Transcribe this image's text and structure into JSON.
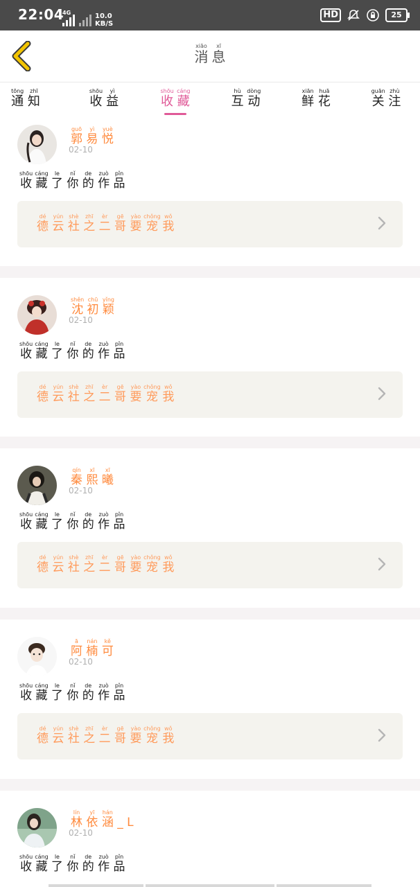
{
  "status_bar": {
    "time": "22:04",
    "net_type": "4G",
    "speed": "10.0",
    "speed_unit": "KB/S",
    "hd": "HD",
    "battery": "25"
  },
  "header": {
    "title": [
      {
        "c": "消",
        "p": "xiāo"
      },
      {
        "c": "息",
        "p": "xī"
      }
    ]
  },
  "tabs": [
    {
      "key": "notice",
      "chars": [
        {
          "c": "通",
          "p": "tōng"
        },
        {
          "c": "知",
          "p": "zhī"
        }
      ]
    },
    {
      "key": "income",
      "chars": [
        {
          "c": "收",
          "p": "shōu"
        },
        {
          "c": "益",
          "p": "yì"
        }
      ]
    },
    {
      "key": "favorite",
      "chars": [
        {
          "c": "收",
          "p": "shōu"
        },
        {
          "c": "藏",
          "p": "cáng"
        }
      ],
      "active": true
    },
    {
      "key": "interact",
      "chars": [
        {
          "c": "互",
          "p": "hù"
        },
        {
          "c": "动",
          "p": "dòng"
        }
      ]
    },
    {
      "key": "flower",
      "chars": [
        {
          "c": "鲜",
          "p": "xiān"
        },
        {
          "c": "花",
          "p": "huā"
        }
      ]
    },
    {
      "key": "follow",
      "chars": [
        {
          "c": "关",
          "p": "guān"
        },
        {
          "c": "注",
          "p": "zhù"
        }
      ]
    }
  ],
  "action_text": [
    {
      "c": "收",
      "p": "shōu"
    },
    {
      "c": "藏",
      "p": "cáng"
    },
    {
      "c": "了",
      "p": "le"
    },
    {
      "c": "你",
      "p": "nǐ"
    },
    {
      "c": "的",
      "p": "de"
    },
    {
      "c": "作",
      "p": "zuò"
    },
    {
      "c": "品",
      "p": "pǐn"
    }
  ],
  "notifications": [
    {
      "user": [
        {
          "c": "郭",
          "p": "guō"
        },
        {
          "c": "易",
          "p": "yì"
        },
        {
          "c": "悦",
          "p": "yuè"
        }
      ],
      "date": "02-10",
      "work": [
        {
          "c": "德",
          "p": "dé"
        },
        {
          "c": "云",
          "p": "yún"
        },
        {
          "c": "社",
          "p": "shè"
        },
        {
          "c": "之",
          "p": "zhī"
        },
        {
          "c": "二",
          "p": "èr"
        },
        {
          "c": "哥",
          "p": "gē"
        },
        {
          "c": "要",
          "p": "yào"
        },
        {
          "c": "宠",
          "p": "chǒng"
        },
        {
          "c": "我",
          "p": "wǒ"
        }
      ],
      "avatar": "girl-white-dress"
    },
    {
      "user": [
        {
          "c": "沈",
          "p": "shěn"
        },
        {
          "c": "初",
          "p": "chū"
        },
        {
          "c": "颖",
          "p": "yǐng"
        }
      ],
      "date": "02-10",
      "work": [
        {
          "c": "德",
          "p": "dé"
        },
        {
          "c": "云",
          "p": "yún"
        },
        {
          "c": "社",
          "p": "shè"
        },
        {
          "c": "之",
          "p": "zhī"
        },
        {
          "c": "二",
          "p": "èr"
        },
        {
          "c": "哥",
          "p": "gē"
        },
        {
          "c": "要",
          "p": "yào"
        },
        {
          "c": "宠",
          "p": "chǒng"
        },
        {
          "c": "我",
          "p": "wǒ"
        }
      ],
      "avatar": "girl-red-costume"
    },
    {
      "user": [
        {
          "c": "秦",
          "p": "qín"
        },
        {
          "c": "熙",
          "p": "xī"
        },
        {
          "c": "曦",
          "p": "xī"
        }
      ],
      "date": "02-10",
      "work": [
        {
          "c": "德",
          "p": "dé"
        },
        {
          "c": "云",
          "p": "yún"
        },
        {
          "c": "社",
          "p": "shè"
        },
        {
          "c": "之",
          "p": "zhī"
        },
        {
          "c": "二",
          "p": "èr"
        },
        {
          "c": "哥",
          "p": "gē"
        },
        {
          "c": "要",
          "p": "yào"
        },
        {
          "c": "宠",
          "p": "chǒng"
        },
        {
          "c": "我",
          "p": "wǒ"
        }
      ],
      "avatar": "dark-portrait"
    },
    {
      "user": [
        {
          "c": "阿",
          "p": "ā"
        },
        {
          "c": "楠",
          "p": "nán"
        },
        {
          "c": "可",
          "p": "kě"
        }
      ],
      "date": "02-10",
      "work": [
        {
          "c": "德",
          "p": "dé"
        },
        {
          "c": "云",
          "p": "yún"
        },
        {
          "c": "社",
          "p": "shè"
        },
        {
          "c": "之",
          "p": "zhī"
        },
        {
          "c": "二",
          "p": "èr"
        },
        {
          "c": "哥",
          "p": "gē"
        },
        {
          "c": "要",
          "p": "yào"
        },
        {
          "c": "宠",
          "p": "chǒng"
        },
        {
          "c": "我",
          "p": "wǒ"
        }
      ],
      "avatar": "boy-light"
    },
    {
      "user": [
        {
          "c": "林",
          "p": "lín"
        },
        {
          "c": "依",
          "p": "yī"
        },
        {
          "c": "涵",
          "p": "hán"
        },
        {
          "c": "_",
          "p": ""
        },
        {
          "c": "L",
          "p": ""
        }
      ],
      "date": "02-10",
      "work": [],
      "avatar": "girl-outdoor"
    }
  ],
  "colors": {
    "accent_pink": "#e05a98",
    "username_orange": "#ff8a3d",
    "work_title_orange": "#ff9a5a",
    "work_bg": "#f4f3ee",
    "separator": "#f6f3f4",
    "status_bg": "#4a4a4a",
    "back_arrow": "#f2c400"
  },
  "icons": {
    "back": "chevron-left-icon",
    "work_arrow": "chevron-right-icon",
    "bell": "bell-off-icon",
    "lock": "rotation-lock-icon"
  }
}
